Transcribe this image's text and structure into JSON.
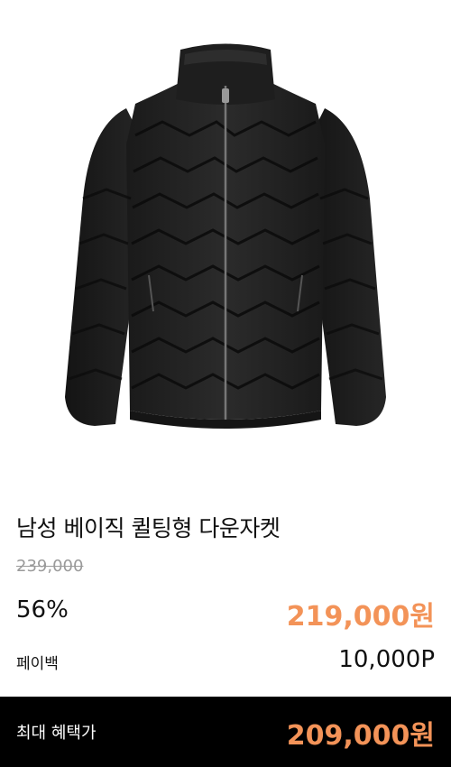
{
  "product": {
    "image_alt": "black quilted down jacket",
    "title": "남성 베이직 퀼팅형 다운자켓",
    "original_price": "239,000",
    "discount_rate": "56%",
    "sale_price": "219,000원",
    "paybak_label": "페이백",
    "paybak_points": "10,000P"
  },
  "benefit": {
    "label": "최대 혜택가",
    "price": "209,000원"
  },
  "colors": {
    "accent": "#f39358",
    "benefit_bar": "#000000"
  }
}
